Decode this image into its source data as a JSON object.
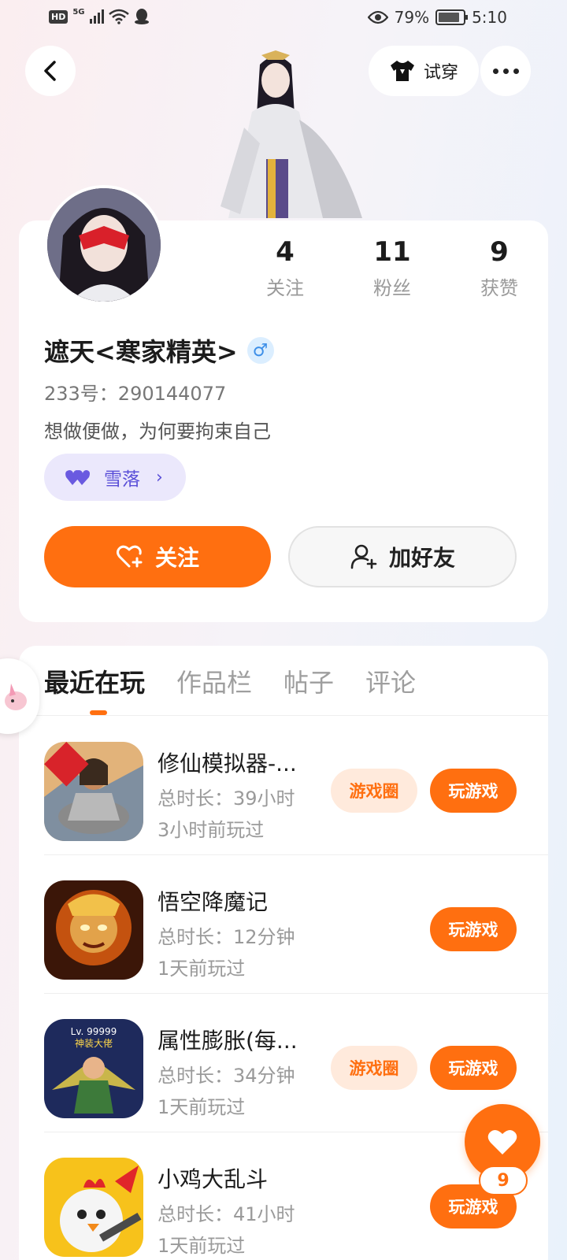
{
  "status_bar": {
    "hd": "HD",
    "network": "5G",
    "battery_pct": "79%",
    "time": "5:10"
  },
  "header": {
    "tryon_label": "试穿"
  },
  "profile": {
    "stats": [
      {
        "value": "4",
        "label": "关注"
      },
      {
        "value": "11",
        "label": "粉丝"
      },
      {
        "value": "9",
        "label": "获赞"
      }
    ],
    "username": "遮天<寒家精英>",
    "gender_icon": "male-icon",
    "uid": "233号：290144077",
    "bio": "想做便做，为何要拘束自己",
    "tag_chip": "雪落",
    "follow_label": "关注",
    "add_friend_label": "加好友"
  },
  "tabs": [
    {
      "label": "最近在玩",
      "active": true
    },
    {
      "label": "作品栏",
      "active": false
    },
    {
      "label": "帖子",
      "active": false
    },
    {
      "label": "评论",
      "active": false
    }
  ],
  "games": [
    {
      "title": "修仙模拟器-...",
      "duration": "总时长：39小时",
      "last_played": "3小时前玩过",
      "circle_label": "游戏圈",
      "play_label": "玩游戏",
      "has_circle": true
    },
    {
      "title": "悟空降魔记",
      "duration": "总时长：12分钟",
      "last_played": "1天前玩过",
      "circle_label": "",
      "play_label": "玩游戏",
      "has_circle": false
    },
    {
      "title": "属性膨胀(每...",
      "duration": "总时长：34分钟",
      "last_played": "1天前玩过",
      "circle_label": "游戏圈",
      "play_label": "玩游戏",
      "has_circle": true
    },
    {
      "title": "小鸡大乱斗",
      "duration": "总时长：41小时",
      "last_played": "1天前玩过",
      "circle_label": "",
      "play_label": "玩游戏",
      "has_circle": false
    }
  ],
  "like_fab": {
    "count": "9"
  },
  "colors": {
    "accent": "#ff6f10",
    "accent_light": "#ffeadc",
    "chip_bg": "#ebe8fc",
    "chip_text": "#5a4fd8"
  }
}
